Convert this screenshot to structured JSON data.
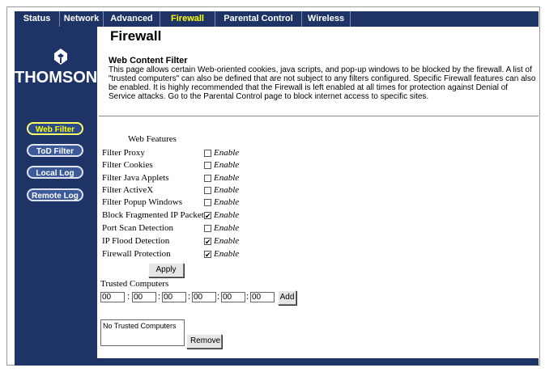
{
  "nav": {
    "tabs": [
      {
        "label": "Status"
      },
      {
        "label": "Network"
      },
      {
        "label": "Advanced"
      },
      {
        "label": "Firewall"
      },
      {
        "label": "Parental Control"
      },
      {
        "label": "Wireless"
      }
    ]
  },
  "logo": {
    "text": "THOMSON"
  },
  "sidebar": {
    "items": [
      {
        "label": "Web Filter"
      },
      {
        "label": "ToD Filter"
      },
      {
        "label": "Local Log"
      },
      {
        "label": "Remote Log"
      }
    ]
  },
  "page": {
    "title": "Firewall",
    "section_title": "Web Content Filter",
    "description": "This page allows certain Web-oriented cookies, java scripts, and pop-up windows to be blocked by the firewall.  A list of \"trusted computers\" can also be defined that are not subject to any filters configured. Specific Firewall features can also be enabled.  It is highly recommended that the Firewall is left enabled at all times for protection against Denial of Service attacks. Go to the Parental Control page to block internet access to specific sites."
  },
  "features": {
    "header": "Web Features",
    "enable_label": "Enable",
    "rows": [
      {
        "label": "Filter Proxy",
        "checked": false
      },
      {
        "label": "Filter Cookies",
        "checked": false
      },
      {
        "label": "Filter Java Applets",
        "checked": false
      },
      {
        "label": "Filter ActiveX",
        "checked": false
      },
      {
        "label": "Filter Popup Windows",
        "checked": false
      },
      {
        "label": "Block Fragmented IP Packets",
        "checked": true
      },
      {
        "label": "Port Scan Detection",
        "checked": false
      },
      {
        "label": "IP Flood Detection",
        "checked": true
      },
      {
        "label": "Firewall Protection",
        "checked": true
      }
    ],
    "apply_label": "Apply"
  },
  "trusted": {
    "label": "Trusted Computers",
    "mac_fields": [
      "00",
      "00",
      "00",
      "00",
      "00",
      "00"
    ],
    "add_label": "Add",
    "list_empty": "No Trusted Computers",
    "remove_label": "Remove"
  },
  "colors": {
    "nav_bg": "#1e3467",
    "active_tab": "#ffff00"
  }
}
